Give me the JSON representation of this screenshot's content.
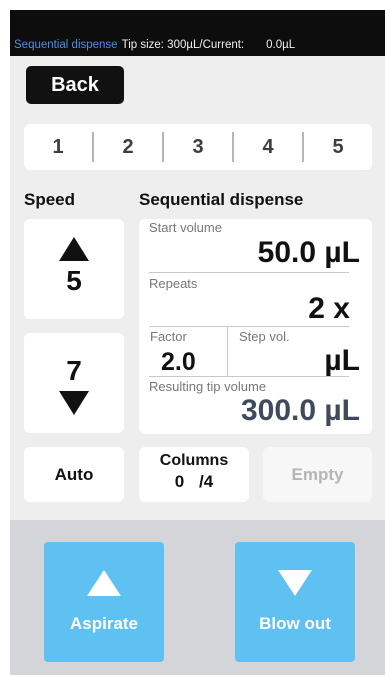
{
  "status": {
    "mode": "Sequential dispense",
    "tip_size": "Tip size:  300µL/Current:",
    "current": "0.0µL"
  },
  "back_label": "Back",
  "tabs": [
    "1",
    "2",
    "3",
    "4",
    "5"
  ],
  "speed": {
    "title": "Speed",
    "up_value": "5",
    "down_value": "7"
  },
  "sequential": {
    "title": "Sequential dispense",
    "start_volume_label": "Start volume",
    "start_volume_value": "50.0 µL",
    "repeats_label": "Repeats",
    "repeats_value": "2 x",
    "factor_label": "Factor",
    "factor_value": "2.0",
    "step_label": "Step vol.",
    "step_value": "µL",
    "resulting_label": "Resulting tip volume",
    "resulting_value": "300.0 µL"
  },
  "auto_label": "Auto",
  "columns": {
    "label": "Columns",
    "current": "0",
    "separator": "/",
    "total": "4"
  },
  "empty_label": "Empty",
  "aspirate_label": "Aspirate",
  "blowout_label": "Blow out",
  "colors": {
    "status_mode": "#4c8ee8",
    "action_button": "#5fc0f2",
    "background": "#eeeeef",
    "accent_text": "#404a5c"
  }
}
